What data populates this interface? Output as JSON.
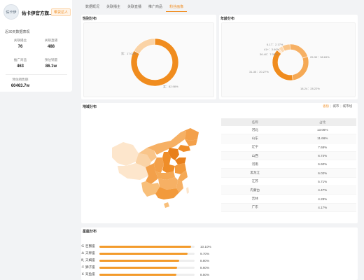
{
  "shop": {
    "logo_text": "佑卡伊",
    "name": "佑卡伊官方旗...",
    "tag": "带货达人"
  },
  "sidebar": {
    "period": "近30天数据表现",
    "stats": [
      {
        "label": "关联播主",
        "value": "76"
      },
      {
        "label": "关联直播",
        "value": "488"
      },
      {
        "label": "推广商品",
        "value": "463"
      },
      {
        "label": "预估销量",
        "value": "86.1w"
      },
      {
        "label": "预估销售额",
        "value": "60463.7w"
      }
    ]
  },
  "tabs": [
    {
      "label": "数据概况",
      "active": false
    },
    {
      "label": "关联播主",
      "active": false
    },
    {
      "label": "关联直播",
      "active": false
    },
    {
      "label": "推广商品",
      "active": false
    },
    {
      "label": "粉丝画像",
      "active": true
    }
  ],
  "colors": {
    "accent": "#f08c1e",
    "accent_light": "#fad3a6",
    "accent_mid": "#f5b56a"
  },
  "gender": {
    "title": "性别分布",
    "male_label": "男：17.02%",
    "female_label": "女：82.98%",
    "male_pct": 17.02,
    "female_pct": 82.98
  },
  "age": {
    "title": "年龄分布",
    "segments": [
      {
        "label": "6-17：2.17%",
        "pct": 2.17
      },
      {
        "label": "41+：3.60%",
        "pct": 3.6
      },
      {
        "label": "36-40：7.05%",
        "pct": 7.05
      },
      {
        "label": "31-35：20.27%",
        "pct": 20.27
      },
      {
        "label": "18-24：28.22%",
        "pct": 28.22
      },
      {
        "label": "25-30：38.69%",
        "pct": 38.69
      }
    ]
  },
  "region": {
    "title": "地域分布",
    "toggles": [
      "省份",
      "城市",
      "城市线"
    ],
    "table_headers": [
      "名称",
      "占比"
    ],
    "rows": [
      [
        "河北",
        "13.06%"
      ],
      [
        "山东",
        "11.66%"
      ],
      [
        "辽宁",
        "7.68%"
      ],
      [
        "山西",
        "6.74%"
      ],
      [
        "河南",
        "6.60%"
      ],
      [
        "黑龙江",
        "6.02%"
      ],
      [
        "江苏",
        "5.71%"
      ],
      [
        "内蒙古",
        "4.47%"
      ],
      [
        "吉林",
        "4.28%"
      ],
      [
        "广东",
        "4.17%"
      ]
    ]
  },
  "stars": {
    "title": "星座分布",
    "rows": [
      {
        "icon": "♋",
        "label": "巨蟹座",
        "value": "10.10%",
        "pct": 10.1
      },
      {
        "icon": "♎",
        "label": "天秤座",
        "value": "9.70%",
        "pct": 9.7
      },
      {
        "icon": "♏",
        "label": "天蝎座",
        "value": "8.80%",
        "pct": 8.8
      },
      {
        "icon": "♌",
        "label": "狮子座",
        "value": "8.60%",
        "pct": 8.6
      },
      {
        "icon": "♓",
        "label": "双鱼座",
        "value": "8.50%",
        "pct": 8.5
      }
    ]
  }
}
